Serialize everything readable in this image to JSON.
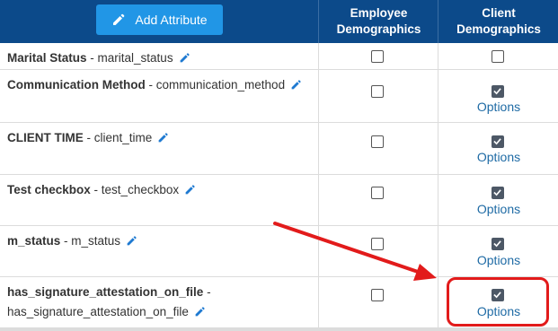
{
  "header": {
    "add_button_label": "Add Attribute",
    "employee_col_line1": "Employee",
    "employee_col_line2": "Demographics",
    "client_col_line1": "Client",
    "client_col_line2": "Demographics"
  },
  "rows": [
    {
      "name": "Marital Status",
      "key": "marital_status",
      "employee_checked": false,
      "client_checked": false,
      "options_label": ""
    },
    {
      "name": "Communication Method",
      "key": "communication_method",
      "employee_checked": false,
      "client_checked": true,
      "options_label": "Options"
    },
    {
      "name": "CLIENT TIME",
      "key": "client_time",
      "employee_checked": false,
      "client_checked": true,
      "options_label": "Options"
    },
    {
      "name": "Test checkbox",
      "key": "test_checkbox",
      "employee_checked": false,
      "client_checked": true,
      "options_label": "Options"
    },
    {
      "name": "m_status",
      "key": "m_status",
      "employee_checked": false,
      "client_checked": true,
      "options_label": "Options"
    },
    {
      "name": "has_signature_attestation_on_file",
      "key": "has_signature_attestation_on_file",
      "employee_checked": false,
      "client_checked": true,
      "options_label": "Options"
    }
  ],
  "separator": " - ",
  "colors": {
    "header_bg": "#0c4a8a",
    "button_bg": "#2196e6",
    "link": "#1f6ba5",
    "annotation": "#e21b1b"
  },
  "icons": [
    "pencil-icon",
    "check-icon",
    "arrow-annotation"
  ]
}
